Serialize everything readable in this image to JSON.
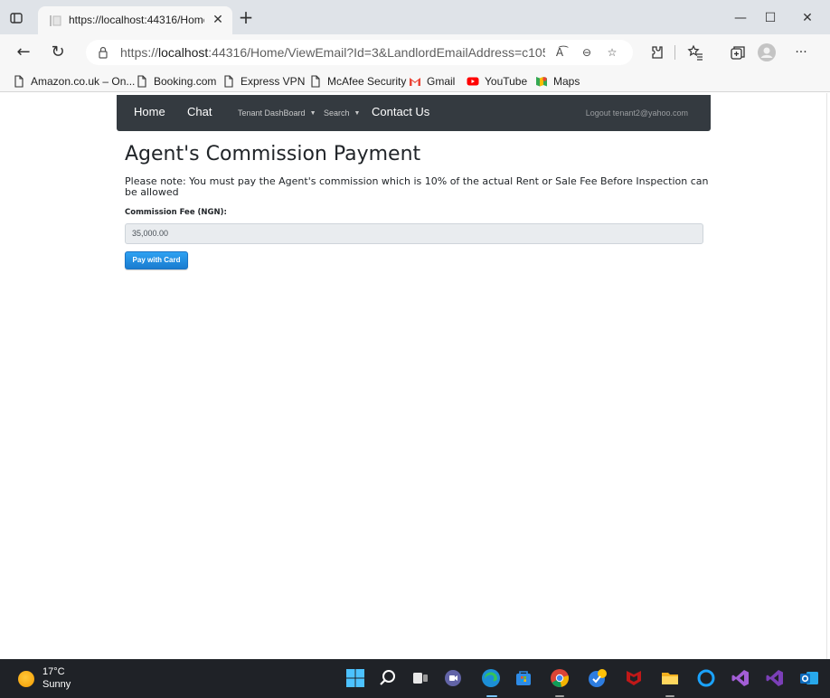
{
  "browser": {
    "tab_title": "https://localhost:44316/Home/V",
    "url_prefix": "https://",
    "url_host": "localhost",
    "url_rest": ":44316/Home/ViewEmail?Id=3&LandlordEmailAddress=c1056529...",
    "bookmarks": [
      {
        "label": "Amazon.co.uk – On...",
        "icon": "page-icon"
      },
      {
        "label": "Booking.com",
        "icon": "page-icon"
      },
      {
        "label": "Express VPN",
        "icon": "page-icon"
      },
      {
        "label": "McAfee Security",
        "icon": "page-icon"
      },
      {
        "label": "Gmail",
        "icon": "gmail-icon"
      },
      {
        "label": "YouTube",
        "icon": "youtube-icon"
      },
      {
        "label": "Maps",
        "icon": "maps-icon"
      }
    ]
  },
  "navbar": {
    "home": "Home",
    "chat": "Chat",
    "tenant_dashboard": "Tenant DashBoard",
    "search": "Search",
    "contact": "Contact Us",
    "logout": "Logout tenant2@yahoo.com"
  },
  "main": {
    "title": "Agent's Commission Payment",
    "note": "Please note: You must pay the Agent's commission which is 10% of the actual Rent or Sale Fee Before Inspection can be allowed",
    "fee_label": "Commission Fee (NGN):",
    "fee_value": "35,000.00",
    "pay_button": "Pay with Card"
  },
  "taskbar": {
    "temperature": "17°C",
    "condition": "Sunny"
  },
  "colors": {
    "navbar_bg": "#343a40",
    "button_blue": "#1a7ccf",
    "taskbar_bg": "#1f2227"
  }
}
